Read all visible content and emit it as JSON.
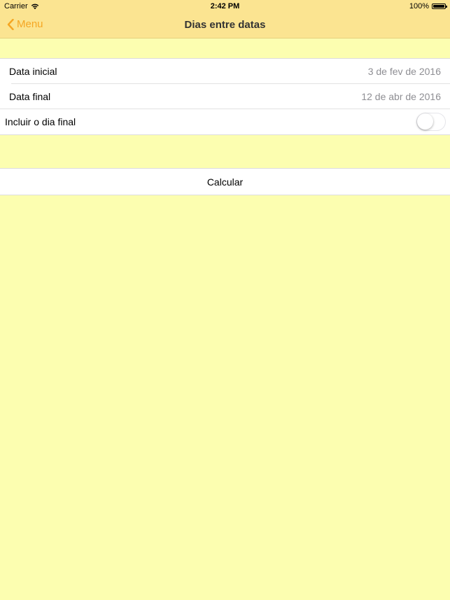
{
  "status_bar": {
    "carrier": "Carrier",
    "time": "2:42 PM",
    "battery": "100%"
  },
  "nav": {
    "back_label": "Menu",
    "title": "Dias entre datas",
    "accent_color": "#F5A623",
    "bar_color": "#FBE491"
  },
  "form": {
    "start_date_label": "Data inicial",
    "start_date_value": "3 de fev de 2016",
    "end_date_label": "Data final",
    "end_date_value": "12 de abr de 2016",
    "include_last_day_label": "Incluir o dia final",
    "include_last_day_on": false
  },
  "actions": {
    "calculate_label": "Calcular"
  },
  "background_color": "#FCFEB0",
  "icons": [
    "wifi-icon",
    "battery-icon",
    "back-chevron-icon"
  ]
}
